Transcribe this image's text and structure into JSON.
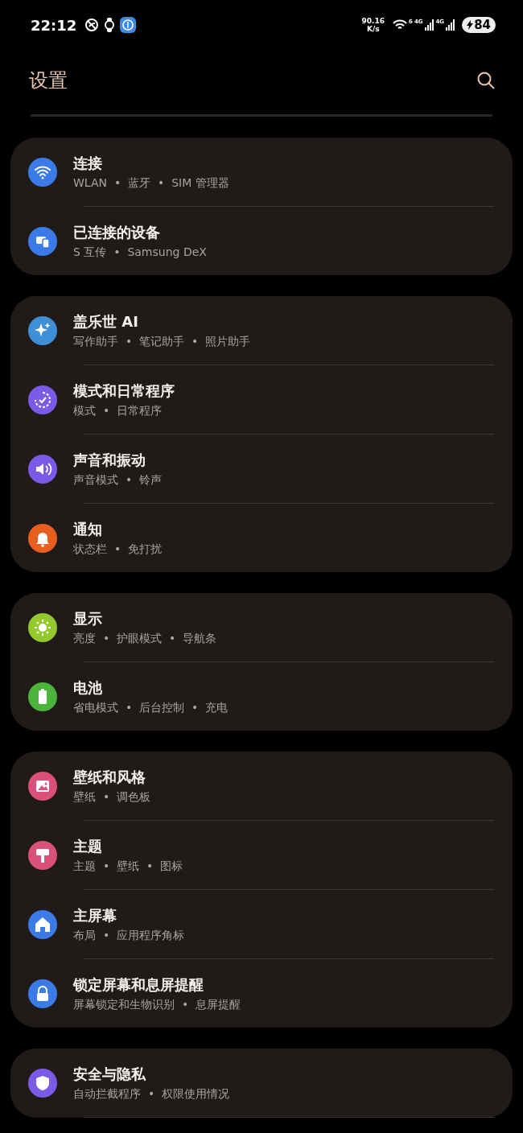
{
  "status_bar": {
    "time": "22:12",
    "net_speed": "90.16",
    "net_unit": "K/s",
    "wifi_badge": "6",
    "sim1": "4G",
    "sim2": "4G",
    "battery": "84"
  },
  "header": {
    "title": "设置"
  },
  "groups": [
    {
      "items": [
        {
          "title": "连接",
          "subtitle": "WLAN  •  蓝牙  •  SIM 管理器",
          "color": "#3a7be8"
        },
        {
          "title": "已连接的设备",
          "subtitle": "S 互传  •  Samsung DeX",
          "color": "#3a7be8"
        }
      ]
    },
    {
      "items": [
        {
          "title": "盖乐世 AI",
          "subtitle": "写作助手  •  笔记助手  •  照片助手",
          "color": "#3f8fd6"
        },
        {
          "title": "模式和日常程序",
          "subtitle": "模式  •  日常程序",
          "color": "#7a5ae6"
        },
        {
          "title": "声音和振动",
          "subtitle": "声音模式  •  铃声",
          "color": "#7a5ae6"
        },
        {
          "title": "通知",
          "subtitle": "状态栏  •  免打扰",
          "color": "#e65f1e"
        }
      ]
    },
    {
      "items": [
        {
          "title": "显示",
          "subtitle": "亮度  •  护眼模式  •  导航条",
          "color": "#93c92c"
        },
        {
          "title": "电池",
          "subtitle": "省电模式  •  后台控制  •  充电",
          "color": "#4cb43a"
        }
      ]
    },
    {
      "items": [
        {
          "title": "壁纸和风格",
          "subtitle": "壁纸  •  调色板",
          "color": "#d9507a"
        },
        {
          "title": "主题",
          "subtitle": "主题  •  壁纸  •  图标",
          "color": "#d9507a"
        },
        {
          "title": "主屏幕",
          "subtitle": "布局  •  应用程序角标",
          "color": "#3a7be8"
        },
        {
          "title": "锁定屏幕和息屏提醒",
          "subtitle": "屏幕锁定和生物识别  •  息屏提醒",
          "color": "#3a7be8"
        }
      ]
    },
    {
      "items": [
        {
          "title": "安全与隐私",
          "subtitle": "自动拦截程序  •  权限使用情况",
          "color": "#7a5ae6"
        }
      ]
    }
  ]
}
